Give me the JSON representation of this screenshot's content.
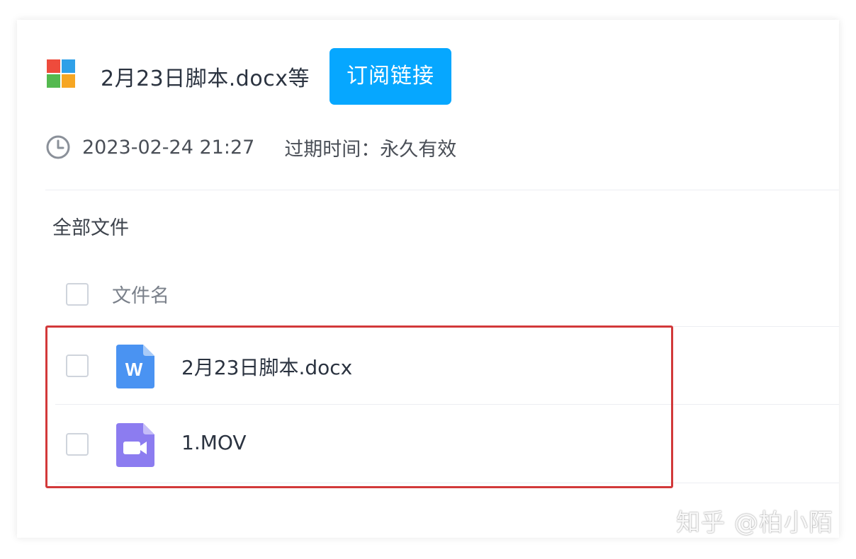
{
  "share": {
    "title": "2月23日脚本.docx等",
    "subscribe_label": "订阅链接",
    "created_at": "2023-02-24 21:27",
    "expiry_label": "过期时间：永久有效"
  },
  "breadcrumb": "全部文件",
  "table": {
    "column_name": "文件名"
  },
  "files": [
    {
      "name": "2月23日脚本.docx",
      "icon": "word-doc-icon"
    },
    {
      "name": "1.MOV",
      "icon": "video-file-icon"
    }
  ],
  "watermark": "知乎 @柏小陌",
  "colors": {
    "accent": "#06a7ff",
    "highlight": "#d2393a",
    "word_icon": "#4a93f2",
    "video_icon": "#8c7cf0"
  }
}
